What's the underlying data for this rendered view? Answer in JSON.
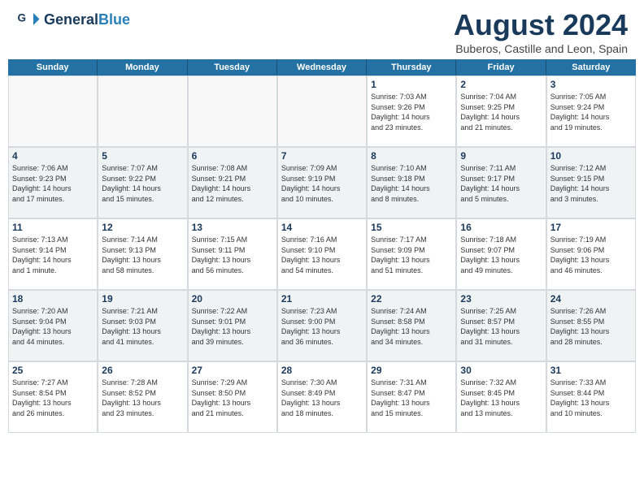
{
  "header": {
    "logo_line1": "General",
    "logo_line2": "Blue",
    "month_year": "August 2024",
    "location": "Buberos, Castille and Leon, Spain"
  },
  "days_of_week": [
    "Sunday",
    "Monday",
    "Tuesday",
    "Wednesday",
    "Thursday",
    "Friday",
    "Saturday"
  ],
  "weeks": [
    [
      {
        "day": "",
        "detail": ""
      },
      {
        "day": "",
        "detail": ""
      },
      {
        "day": "",
        "detail": ""
      },
      {
        "day": "",
        "detail": ""
      },
      {
        "day": "1",
        "detail": "Sunrise: 7:03 AM\nSunset: 9:26 PM\nDaylight: 14 hours\nand 23 minutes."
      },
      {
        "day": "2",
        "detail": "Sunrise: 7:04 AM\nSunset: 9:25 PM\nDaylight: 14 hours\nand 21 minutes."
      },
      {
        "day": "3",
        "detail": "Sunrise: 7:05 AM\nSunset: 9:24 PM\nDaylight: 14 hours\nand 19 minutes."
      }
    ],
    [
      {
        "day": "4",
        "detail": "Sunrise: 7:06 AM\nSunset: 9:23 PM\nDaylight: 14 hours\nand 17 minutes."
      },
      {
        "day": "5",
        "detail": "Sunrise: 7:07 AM\nSunset: 9:22 PM\nDaylight: 14 hours\nand 15 minutes."
      },
      {
        "day": "6",
        "detail": "Sunrise: 7:08 AM\nSunset: 9:21 PM\nDaylight: 14 hours\nand 12 minutes."
      },
      {
        "day": "7",
        "detail": "Sunrise: 7:09 AM\nSunset: 9:19 PM\nDaylight: 14 hours\nand 10 minutes."
      },
      {
        "day": "8",
        "detail": "Sunrise: 7:10 AM\nSunset: 9:18 PM\nDaylight: 14 hours\nand 8 minutes."
      },
      {
        "day": "9",
        "detail": "Sunrise: 7:11 AM\nSunset: 9:17 PM\nDaylight: 14 hours\nand 5 minutes."
      },
      {
        "day": "10",
        "detail": "Sunrise: 7:12 AM\nSunset: 9:15 PM\nDaylight: 14 hours\nand 3 minutes."
      }
    ],
    [
      {
        "day": "11",
        "detail": "Sunrise: 7:13 AM\nSunset: 9:14 PM\nDaylight: 14 hours\nand 1 minute."
      },
      {
        "day": "12",
        "detail": "Sunrise: 7:14 AM\nSunset: 9:13 PM\nDaylight: 13 hours\nand 58 minutes."
      },
      {
        "day": "13",
        "detail": "Sunrise: 7:15 AM\nSunset: 9:11 PM\nDaylight: 13 hours\nand 56 minutes."
      },
      {
        "day": "14",
        "detail": "Sunrise: 7:16 AM\nSunset: 9:10 PM\nDaylight: 13 hours\nand 54 minutes."
      },
      {
        "day": "15",
        "detail": "Sunrise: 7:17 AM\nSunset: 9:09 PM\nDaylight: 13 hours\nand 51 minutes."
      },
      {
        "day": "16",
        "detail": "Sunrise: 7:18 AM\nSunset: 9:07 PM\nDaylight: 13 hours\nand 49 minutes."
      },
      {
        "day": "17",
        "detail": "Sunrise: 7:19 AM\nSunset: 9:06 PM\nDaylight: 13 hours\nand 46 minutes."
      }
    ],
    [
      {
        "day": "18",
        "detail": "Sunrise: 7:20 AM\nSunset: 9:04 PM\nDaylight: 13 hours\nand 44 minutes."
      },
      {
        "day": "19",
        "detail": "Sunrise: 7:21 AM\nSunset: 9:03 PM\nDaylight: 13 hours\nand 41 minutes."
      },
      {
        "day": "20",
        "detail": "Sunrise: 7:22 AM\nSunset: 9:01 PM\nDaylight: 13 hours\nand 39 minutes."
      },
      {
        "day": "21",
        "detail": "Sunrise: 7:23 AM\nSunset: 9:00 PM\nDaylight: 13 hours\nand 36 minutes."
      },
      {
        "day": "22",
        "detail": "Sunrise: 7:24 AM\nSunset: 8:58 PM\nDaylight: 13 hours\nand 34 minutes."
      },
      {
        "day": "23",
        "detail": "Sunrise: 7:25 AM\nSunset: 8:57 PM\nDaylight: 13 hours\nand 31 minutes."
      },
      {
        "day": "24",
        "detail": "Sunrise: 7:26 AM\nSunset: 8:55 PM\nDaylight: 13 hours\nand 28 minutes."
      }
    ],
    [
      {
        "day": "25",
        "detail": "Sunrise: 7:27 AM\nSunset: 8:54 PM\nDaylight: 13 hours\nand 26 minutes."
      },
      {
        "day": "26",
        "detail": "Sunrise: 7:28 AM\nSunset: 8:52 PM\nDaylight: 13 hours\nand 23 minutes."
      },
      {
        "day": "27",
        "detail": "Sunrise: 7:29 AM\nSunset: 8:50 PM\nDaylight: 13 hours\nand 21 minutes."
      },
      {
        "day": "28",
        "detail": "Sunrise: 7:30 AM\nSunset: 8:49 PM\nDaylight: 13 hours\nand 18 minutes."
      },
      {
        "day": "29",
        "detail": "Sunrise: 7:31 AM\nSunset: 8:47 PM\nDaylight: 13 hours\nand 15 minutes."
      },
      {
        "day": "30",
        "detail": "Sunrise: 7:32 AM\nSunset: 8:45 PM\nDaylight: 13 hours\nand 13 minutes."
      },
      {
        "day": "31",
        "detail": "Sunrise: 7:33 AM\nSunset: 8:44 PM\nDaylight: 13 hours\nand 10 minutes."
      }
    ]
  ]
}
